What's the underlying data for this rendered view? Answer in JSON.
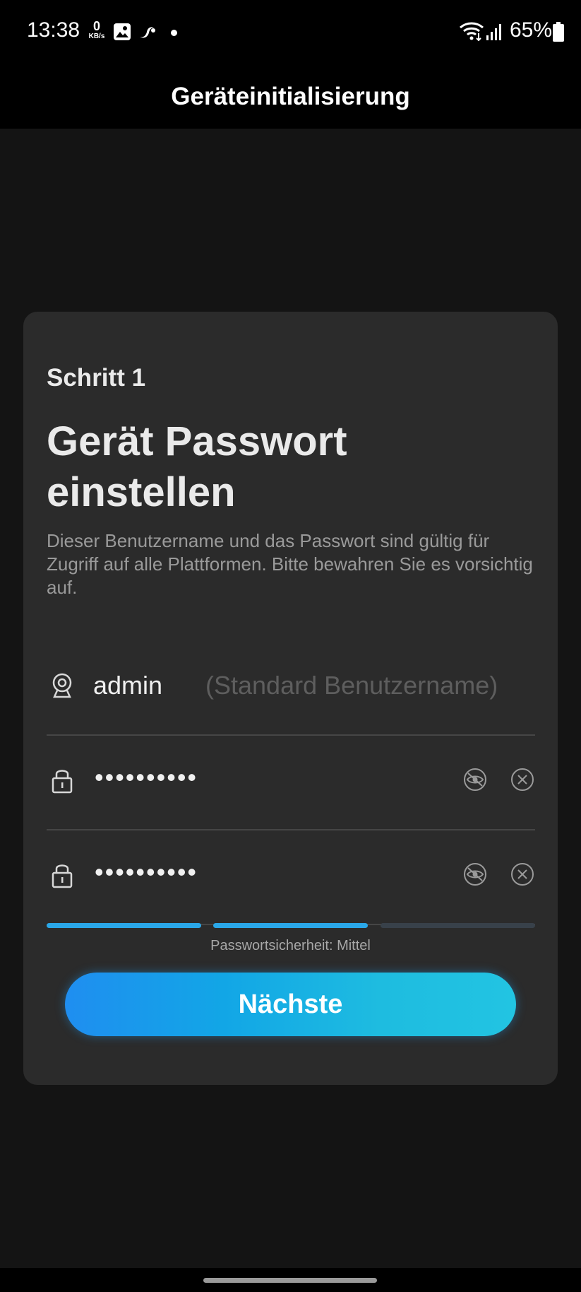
{
  "status_bar": {
    "time": "13:38",
    "data_rate_value": "0",
    "data_rate_unit": "KB/s",
    "battery_percent": "65%",
    "icons": [
      "gallery-icon",
      "app-swirl-icon",
      "notification-dot",
      "wifi-icon",
      "signal-icon",
      "battery-icon"
    ]
  },
  "header": {
    "title": "Geräteinitialisierung"
  },
  "card": {
    "step_label": "Schritt 1",
    "heading": "Gerät Passwort einstellen",
    "description": "Dieser Benutzername und das Passwort sind gültig für Zugriff auf alle Plattformen. Bitte bewahren Sie es vorsichtig auf.",
    "username": {
      "value": "admin",
      "hint": "(Standard Benutzername)",
      "icon": "webcam-icon"
    },
    "password": {
      "masked_value": "••••••••••",
      "icon": "lock-icon",
      "toggle_icon": "eye-hidden-icon",
      "clear_icon": "clear-icon"
    },
    "password_confirm": {
      "masked_value": "••••••••••",
      "icon": "lock-icon",
      "toggle_icon": "eye-hidden-icon",
      "clear_icon": "clear-icon"
    },
    "strength": {
      "label": "Passwortsicherheit: Mittel",
      "filled_segments": 2,
      "total_segments": 3
    },
    "next_button_label": "Nächste"
  },
  "colors": {
    "background": "#141414",
    "card": "#2b2b2b",
    "accent": "#2aa7e8",
    "button_gradient_start": "#1f8ef0",
    "button_gradient_end": "#22c4e2"
  }
}
